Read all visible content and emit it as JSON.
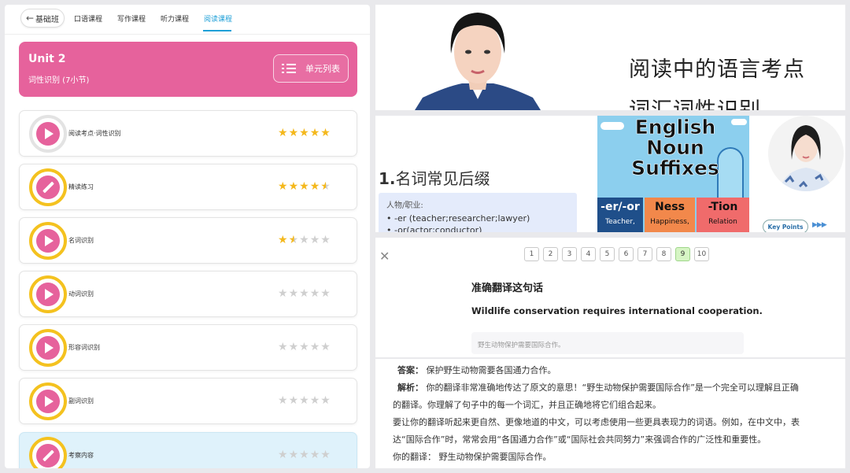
{
  "nav": {
    "back_label": "基础班",
    "tabs": [
      {
        "label": "口语课程"
      },
      {
        "label": "写作课程"
      },
      {
        "label": "听力课程"
      },
      {
        "label": "阅读课程"
      }
    ]
  },
  "unit": {
    "title": "Unit 2",
    "subtitle": "词性识别 (7小节)",
    "list_button": "单元列表"
  },
  "lessons": [
    {
      "name": "阅读考点·词性识别",
      "icon": "play-icon",
      "rating": 5
    },
    {
      "name": "精读练习",
      "icon": "pencil-icon",
      "rating": 4.5
    },
    {
      "name": "名词识别",
      "icon": "play-icon",
      "rating": 1.5
    },
    {
      "name": "动词识别",
      "icon": "play-icon",
      "rating": 0
    },
    {
      "name": "形容词识别",
      "icon": "play-icon",
      "rating": 0
    },
    {
      "name": "副词识别",
      "icon": "play-icon",
      "rating": 0
    },
    {
      "name": "考察内容",
      "icon": "pencil-icon",
      "rating": 0
    }
  ],
  "video": {
    "title_line1": "阅读中的语言考点",
    "title_line2": "词汇词性识别"
  },
  "slide": {
    "heading_num": "1.",
    "heading_text": "名词常见后缀",
    "box_label": "人物/职业:",
    "box_items": [
      "-er (teacher;researcher;lawyer)",
      "-or(actor;conductor)"
    ],
    "image_title_lines": [
      "English",
      "Noun",
      "Suffixes"
    ],
    "suffixes": [
      {
        "label": "-er/-or",
        "example": "Teacher,",
        "color": "#1f4f8a"
      },
      {
        "label": "Ness",
        "example": "Happiness,",
        "color": "#f2884b"
      },
      {
        "label": "-Tion",
        "example": "Relation",
        "color": "#f06b6b"
      }
    ],
    "key_points_label": "Key Points",
    "key_points_arrows": "▶▶▶"
  },
  "quiz": {
    "numbers": [
      "1",
      "2",
      "3",
      "4",
      "5",
      "6",
      "7",
      "8",
      "9",
      "10"
    ],
    "current": "9",
    "title": "准确翻译这句话",
    "sentence": "Wildlife conservation requires international cooperation.",
    "user_answer": "野生动物保护需要国际合作。"
  },
  "feedback": {
    "answer_label": "答案",
    "answer_text": "保护野生动物需要各国通力合作。",
    "analysis_label": "解析",
    "analysis_text": "你的翻译非常准确地传达了原文的意思！“野生动物保护需要国际合作”是一个完全可以理解且正确",
    "analysis_text2": "的翻译。你理解了句子中的每一个词汇，并且正确地将它们组合起来。",
    "para2_line1": "要让你的翻译听起来更自然、更像地道的中文，可以考虑使用一些更具表现力的词语。例如，在中文中，表",
    "para2_line2": "达“国际合作”时，常常会用“各国通力合作”或“国际社会共同努力”来强调合作的广泛性和重要性。",
    "your_label": "你的翻译",
    "your_text": "野生动物保护需要国际合作。"
  }
}
